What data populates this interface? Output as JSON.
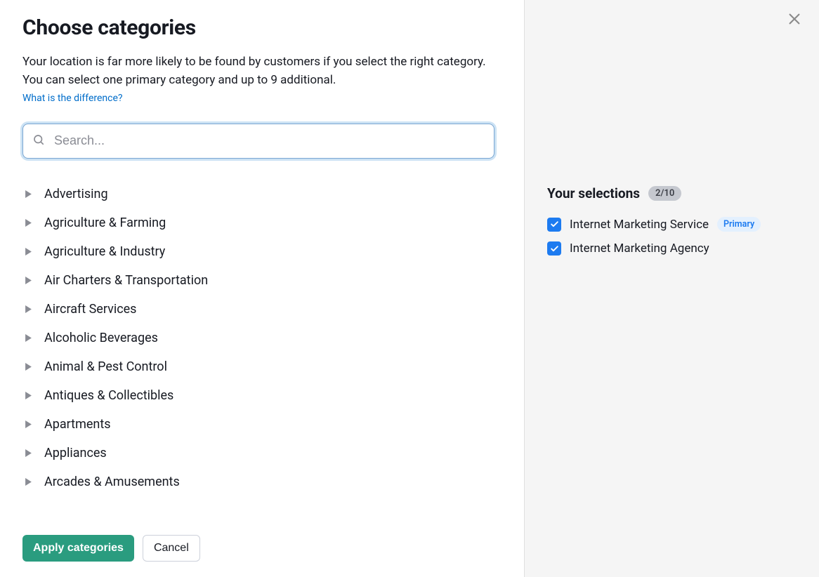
{
  "heading": "Choose categories",
  "description": "Your location is far more likely to be found by customers if you select the right category. You can select one primary category and up to 9 additional.",
  "help_link": "What is the difference?",
  "search": {
    "placeholder": "Search..."
  },
  "categories": [
    "Advertising",
    "Agriculture & Farming",
    "Agriculture & Industry",
    "Air Charters & Transportation",
    "Aircraft Services",
    "Alcoholic Beverages",
    "Animal & Pest Control",
    "Antiques & Collectibles",
    "Apartments",
    "Appliances",
    "Arcades & Amusements"
  ],
  "actions": {
    "apply": "Apply categories",
    "cancel": "Cancel"
  },
  "selections": {
    "title": "Your selections",
    "count": "2/10",
    "primary_label": "Primary",
    "items": [
      {
        "label": "Internet Marketing Service",
        "primary": true
      },
      {
        "label": "Internet Marketing Agency",
        "primary": false
      }
    ]
  }
}
